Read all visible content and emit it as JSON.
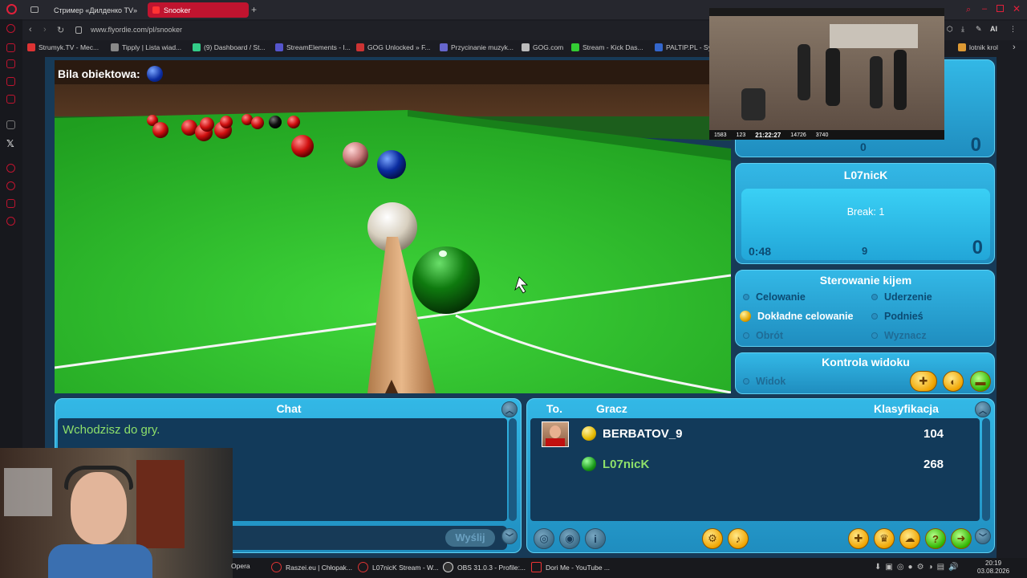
{
  "browser": {
    "tabs": [
      {
        "label": "Стример «Дилденко TV»",
        "active": false
      },
      {
        "label": "Snooker",
        "active": true
      }
    ],
    "new_tab": "+",
    "url": "www.flyordie.com/pl/snooker",
    "ai_label": "AI",
    "bookmarks": [
      {
        "label": "Strumyk.TV - Mec...",
        "color": "#d33"
      },
      {
        "label": "Tipply | Lista wiad...",
        "color": "#888"
      },
      {
        "label": "(9) Dashboard / St...",
        "color": "#3c8"
      },
      {
        "label": "StreamElements - I...",
        "color": "#55c"
      },
      {
        "label": "GOG Unlocked » F...",
        "color": "#c33"
      },
      {
        "label": "Przycinanie muzyk...",
        "color": "#66c"
      },
      {
        "label": "GOG.com",
        "color": "#bbb"
      },
      {
        "label": "Stream - Kick Das...",
        "color": "#3c3"
      },
      {
        "label": "PALTIP.PL - Sy",
        "color": "#36c"
      },
      {
        "label": "lotnik krol",
        "color": "#d93"
      }
    ]
  },
  "game": {
    "object_ball_label": "Bila obiektowa:",
    "player_top_break": "0",
    "player_top_score": "0",
    "player2": {
      "name": "L07nicK",
      "break": "Break: 1",
      "time": "0:48",
      "shots": "9",
      "score": "0"
    },
    "cue_control": {
      "title": "Sterowanie kijem",
      "options": [
        {
          "label": "Celowanie",
          "state": "normal"
        },
        {
          "label": "Uderzenie",
          "state": "normal"
        },
        {
          "label": "Dokładne celowanie",
          "state": "active"
        },
        {
          "label": "Podnieś",
          "state": "normal"
        },
        {
          "label": "Obrót",
          "state": "dim"
        },
        {
          "label": "Wyznacz",
          "state": "dim"
        }
      ]
    },
    "view_control": {
      "title": "Kontrola widoku",
      "option": "Widok"
    },
    "chat": {
      "title": "Chat",
      "message": "Wchodzisz do gry.",
      "send_label": "Wyślij"
    },
    "ranking": {
      "col_to": "To.",
      "col_player": "Gracz",
      "col_rank": "Klasyfikacja",
      "players": [
        {
          "name": "BERBATOV_9",
          "rating": "104",
          "ball_color": "#e8c000"
        },
        {
          "name": "L07nicK",
          "rating": "268",
          "ball_color": "#1a9a1a"
        }
      ]
    }
  },
  "stream_overlay": {
    "timer": "21:22:27",
    "stats": [
      "1583",
      "123",
      "14726",
      "3740"
    ]
  },
  "taskbar": {
    "items": [
      "Opera",
      "Raszei.eu | Chłopak...",
      "L07nicK Stream - W...",
      "OBS 31.0.3 - Profile:...",
      "Dori Me - YouTube ..."
    ],
    "time": "20:19",
    "date": "03.08.2026"
  }
}
